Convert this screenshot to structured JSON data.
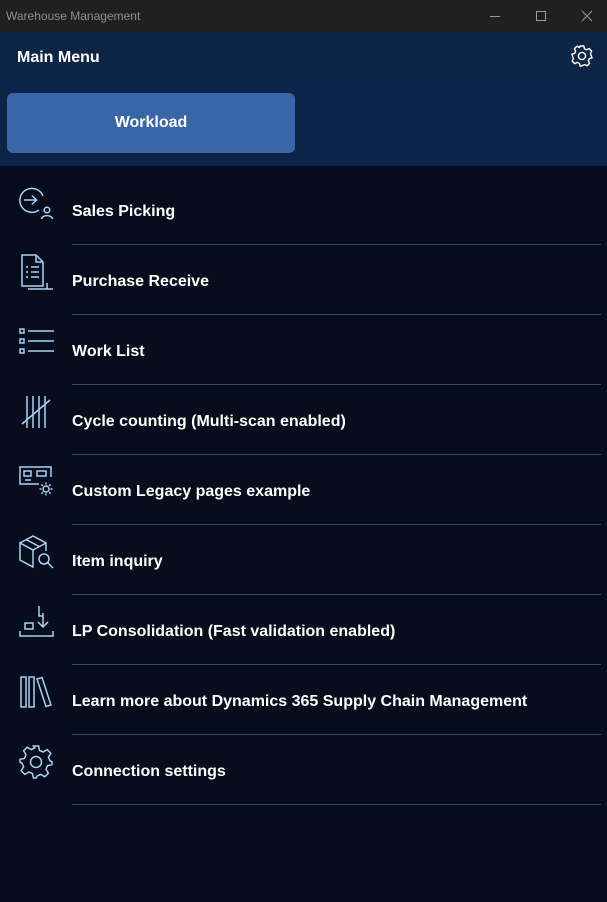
{
  "window": {
    "title": "Warehouse Management",
    "controls": [
      "minimize-icon",
      "maximize-icon",
      "close-icon"
    ]
  },
  "header": {
    "title": "Main Menu",
    "settings_icon": "gear-icon"
  },
  "workload": {
    "label": "Workload"
  },
  "menu": {
    "items": [
      {
        "label": "Sales Picking",
        "icon": "sales-picking-icon"
      },
      {
        "label": "Purchase Receive",
        "icon": "purchase-receive-icon"
      },
      {
        "label": "Work List",
        "icon": "work-list-icon"
      },
      {
        "label": "Cycle counting (Multi-scan enabled)",
        "icon": "tally-icon"
      },
      {
        "label": "Custom Legacy pages example",
        "icon": "custom-pages-icon"
      },
      {
        "label": "Item inquiry",
        "icon": "item-inquiry-icon"
      },
      {
        "label": "LP Consolidation (Fast validation enabled)",
        "icon": "lp-consolidation-icon"
      },
      {
        "label": "Learn more about Dynamics 365 Supply Chain Management",
        "icon": "library-icon"
      },
      {
        "label": "Connection settings",
        "icon": "gear-icon"
      }
    ]
  },
  "colors": {
    "header_bg": "#0e2445",
    "workload_bg": "#0b2447",
    "button_bg": "#3866a6",
    "page_bg": "#070d1c",
    "icon_color": "#a9d2f5"
  }
}
